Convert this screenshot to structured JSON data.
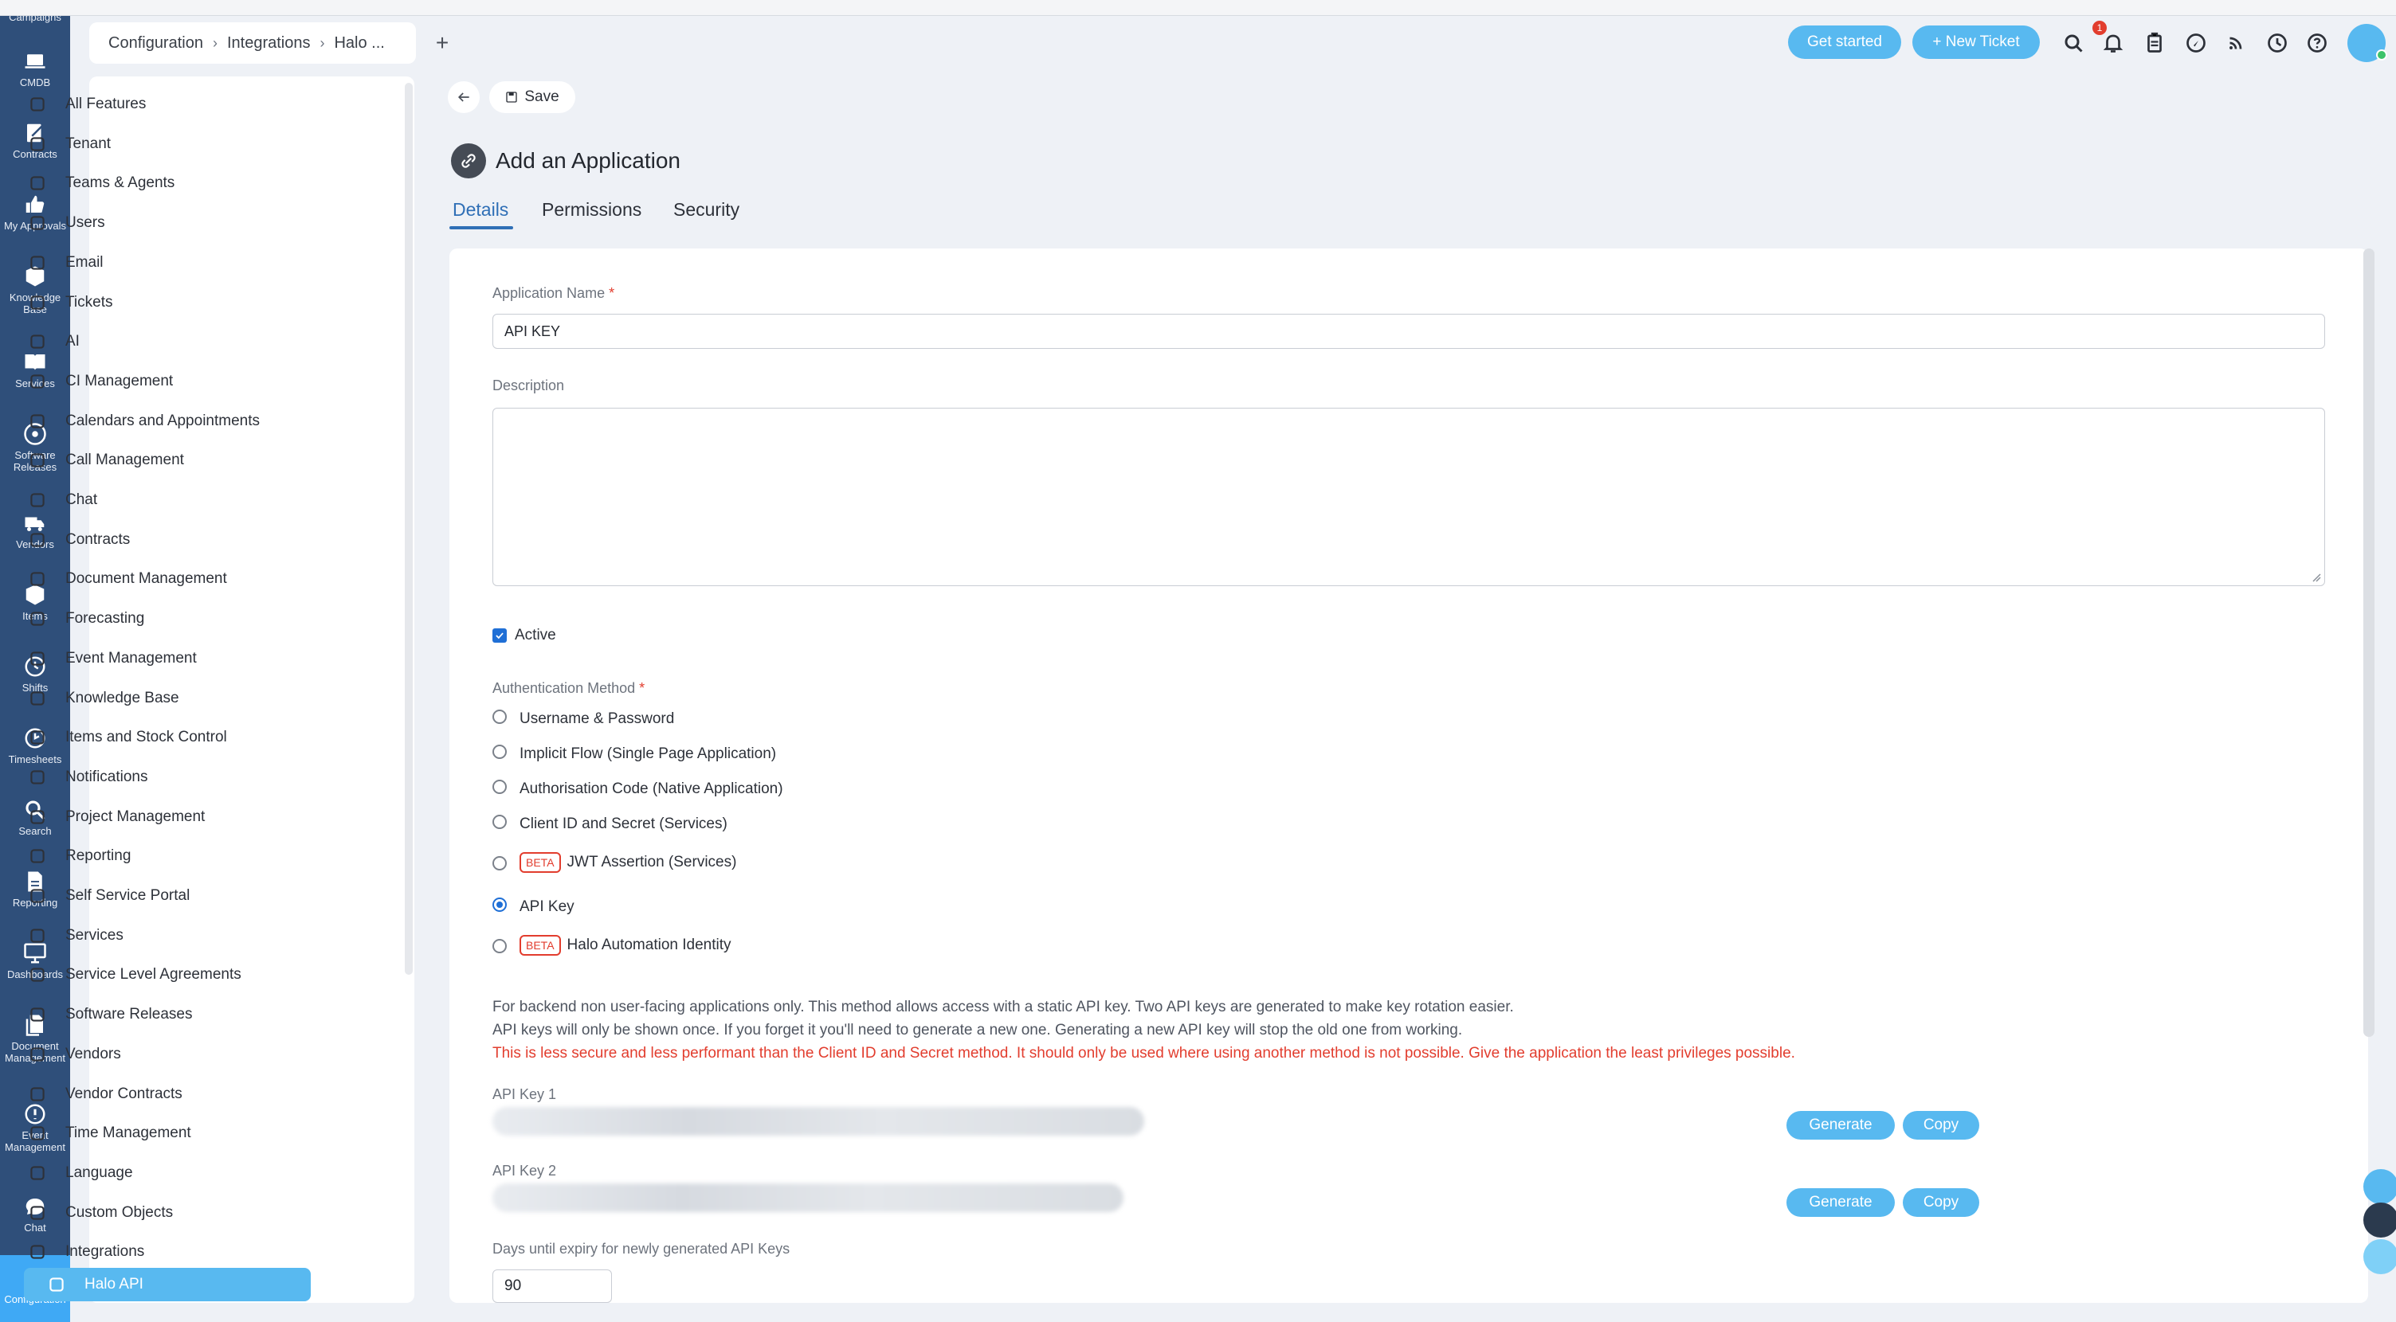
{
  "rail": {
    "partial_top": "Campaigns",
    "items": [
      {
        "label": "CMDB"
      },
      {
        "label": "Contracts"
      },
      {
        "label": "My Approvals"
      },
      {
        "label": "Knowledge Base"
      },
      {
        "label": "Services"
      },
      {
        "label": "Software Releases"
      },
      {
        "label": "Vendors"
      },
      {
        "label": "Items"
      },
      {
        "label": "Shifts"
      },
      {
        "label": "Timesheets"
      },
      {
        "label": "Search"
      },
      {
        "label": "Reporting"
      },
      {
        "label": "Dashboards"
      },
      {
        "label": "Document Management"
      },
      {
        "label": "Event Management"
      },
      {
        "label": "Chat"
      },
      {
        "label": "Configuration"
      }
    ]
  },
  "breadcrumb": {
    "items": [
      "Configuration",
      "Integrations",
      "Halo ..."
    ],
    "add_tab": "+"
  },
  "toolbar": {
    "get_started": "Get started",
    "new_ticket": "+ New Ticket",
    "notification_count": "1"
  },
  "features": {
    "items": [
      "All Features",
      "Tenant",
      "Teams & Agents",
      "Users",
      "Email",
      "Tickets",
      "AI",
      "CI Management",
      "Calendars and Appointments",
      "Call Management",
      "Chat",
      "Contracts",
      "Document Management",
      "Forecasting",
      "Event Management",
      "Knowledge Base",
      "Items and Stock Control",
      "Notifications",
      "Project Management",
      "Reporting",
      "Self Service Portal",
      "Services",
      "Service Level Agreements",
      "Software Releases",
      "Vendors",
      "Vendor Contracts",
      "Time Management",
      "Language",
      "Custom Objects",
      "Integrations",
      "Halo API"
    ]
  },
  "main": {
    "save_label": "Save",
    "title": "Add an Application",
    "tabs": [
      "Details",
      "Permissions",
      "Security"
    ],
    "app_name_label": "Application Name",
    "app_name_value": "API KEY",
    "description_label": "Description",
    "active_label": "Active",
    "auth_label": "Authentication Method",
    "auth_options": [
      {
        "label": "Username & Password",
        "beta": false,
        "checked": false
      },
      {
        "label": "Implicit Flow (Single Page Application)",
        "beta": false,
        "checked": false
      },
      {
        "label": "Authorisation Code (Native Application)",
        "beta": false,
        "checked": false
      },
      {
        "label": "Client ID and Secret (Services)",
        "beta": false,
        "checked": false
      },
      {
        "label": "JWT Assertion (Services)",
        "beta": true,
        "checked": false
      },
      {
        "label": "API Key",
        "beta": false,
        "checked": true
      },
      {
        "label": "Halo Automation Identity",
        "beta": true,
        "checked": false
      }
    ],
    "beta_label": "BETA",
    "info_line1": "For backend non user-facing applications only. This method allows access with a static API key. Two API keys are generated to make key rotation easier.",
    "info_line2": "API keys will only be shown once. If you forget it you'll need to generate a new one. Generating a new API key will stop the old one from working.",
    "warning": "This is less secure and less performant than the Client ID and Secret method. It should only be used where using another method is not possible. Give the application the least privileges possible.",
    "api_key1_label": "API Key 1",
    "api_key2_label": "API Key 2",
    "generate_label": "Generate",
    "copy_label": "Copy",
    "days_label": "Days until expiry for newly generated API Keys",
    "days_value": "90"
  },
  "colors": {
    "rail_bg": "#2f4f7a",
    "accent": "#58b9f0",
    "tab_active": "#2f6fb6",
    "warning": "#e23d2e"
  }
}
